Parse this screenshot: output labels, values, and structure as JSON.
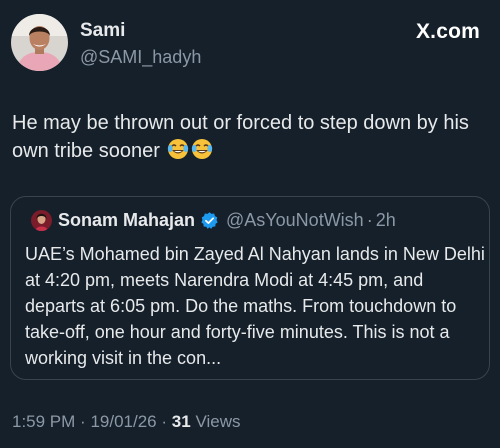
{
  "brand": {
    "label": "X.com"
  },
  "author": {
    "display_name": "Sami",
    "handle": "@SAMI_hadyh"
  },
  "tweet": {
    "text": "He may be thrown out or forced to step down by his own tribe sooner",
    "emojis": [
      "face-with-tears-of-joy",
      "face-with-tears-of-joy"
    ]
  },
  "quoted_tweet": {
    "display_name": "Sonam Mahajan",
    "verified": true,
    "handle": "@AsYouNotWish",
    "separator": "·",
    "time": "2h",
    "text": "UAE’s Mohamed bin Zayed Al Nahyan lands in New Delhi at 4:20 pm, meets Narendra Modi at 4:45 pm, and departs at 6:05 pm. Do the maths. From touchdown to take-off, one hour and forty-five minutes. This is not a working visit in the con..."
  },
  "meta": {
    "time": "1:59 PM",
    "separator_1": "·",
    "date": "19/01/26",
    "separator_2": "·",
    "views_count": "31",
    "views_label": "Views"
  },
  "colors": {
    "background": "#15202b",
    "text_primary": "#e7e9ea",
    "text_secondary": "#8b98a5",
    "border": "#38444d",
    "verified_blue": "#1d9bf0"
  }
}
